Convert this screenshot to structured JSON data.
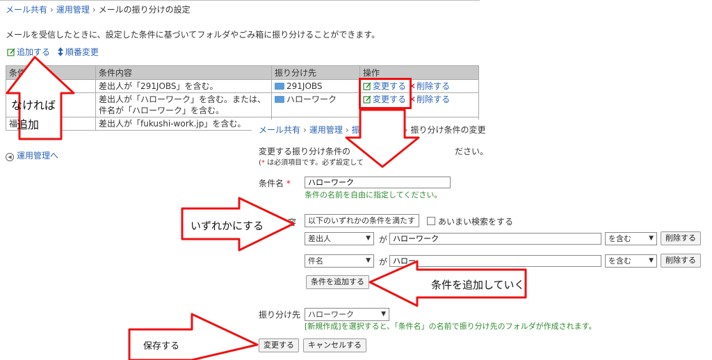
{
  "breadcrumb": {
    "items": [
      "メール共有",
      "運用管理",
      "メールの振り分けの設定"
    ],
    "separator": "›"
  },
  "description": "メールを受信したときに、設定した条件に基づいてフォルダやごみ箱に振り分けることができます。",
  "actions": {
    "add": "追加する",
    "reorder": "順番変更"
  },
  "table": {
    "headers": [
      "条件名",
      "条件内容",
      "振り分け先",
      "操作"
    ],
    "rows": [
      {
        "name": "",
        "condition": "差出人が「291JOBS」を含む。",
        "dest": "291JOBS",
        "edit": "変更する",
        "delete": "削除する"
      },
      {
        "name": "",
        "condition": "差出人が「ハローワーク」を含む。または、",
        "condition2": "件名が「ハローワーク」を含む。",
        "dest": "ハローワーク",
        "edit": "変更する",
        "delete": "削除する"
      },
      {
        "name": "福",
        "condition": "差出人が「fukushi-work.jp」を含む。"
      }
    ]
  },
  "back_link": "運用管理へ",
  "dialog": {
    "breadcrumb": {
      "a": "メール共有",
      "b": "運用管理",
      "c": "振り分けの…",
      "d": "振り分け条件の変更"
    },
    "description": "変更する振り分け条件の",
    "description_tail": "ださい。",
    "required_note": "は必須項目です。必ず設定して",
    "condition_name": {
      "label": "条件名",
      "value": "ハローワーク",
      "help": "条件の名前を自由に指定してください。"
    },
    "condition_content": {
      "label_tail": "容",
      "match_mode": "以下のいずれかの条件を満たす",
      "fuzzy_label": "あいまい検索をする",
      "rows": [
        {
          "field": "差出人",
          "particle": "が",
          "value": "ハローワーク",
          "op": "を含む",
          "delete": "削除する"
        },
        {
          "field": "件名",
          "particle": "が",
          "value": "ハロー",
          "op": "を含む",
          "delete": "削除する"
        }
      ],
      "add_condition": "条件を追加する"
    },
    "destination": {
      "label": "振り分け先",
      "value": "ハローワーク",
      "help": "[新規作成]を選択すると、「条件名」の名前で振り分け先のフォルダが作成されます。"
    },
    "submit": "変更する",
    "cancel": "キャンセルする"
  },
  "annotations": {
    "add_note_line1": "なければ",
    "add_note_line2": "追加",
    "either_note": "いずれかにする",
    "add_condition_note": "条件を追加していく",
    "save_note": "保存する",
    "arrow_color": "#e11"
  }
}
